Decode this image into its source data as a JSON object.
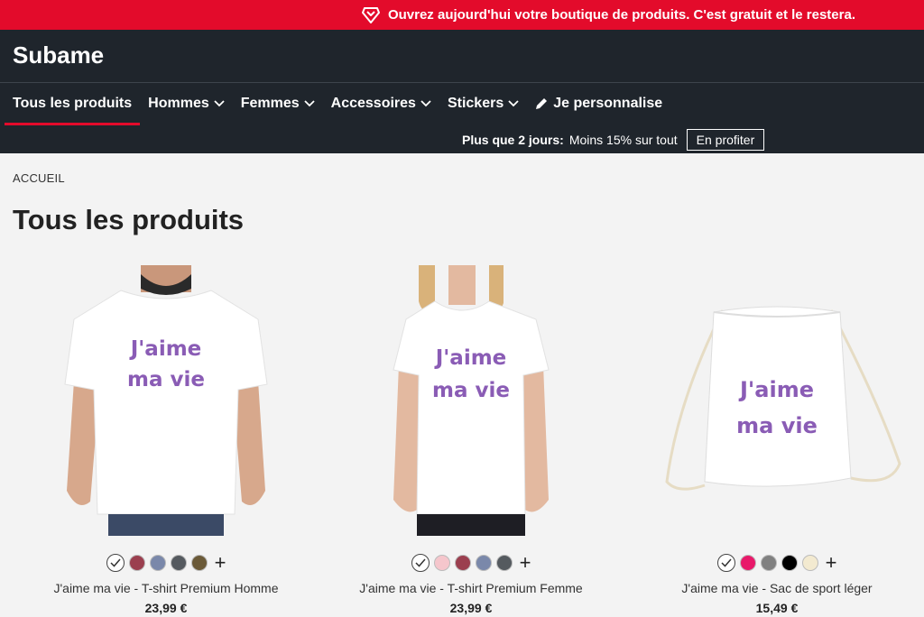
{
  "promo": {
    "text": "Ouvrez aujourd'hui votre boutique de produits. C'est gratuit et le restera.",
    "icon": "diamond-heart-icon"
  },
  "header": {
    "brand": "Subame",
    "nav": [
      {
        "label": "Tous les produits",
        "active": true
      },
      {
        "label": "Hommes",
        "dropdown": true
      },
      {
        "label": "Femmes",
        "dropdown": true
      },
      {
        "label": "Accessoires",
        "dropdown": true
      },
      {
        "label": "Stickers",
        "dropdown": true
      },
      {
        "label": "Je personnalise",
        "icon": "pencil-icon"
      }
    ],
    "offer": {
      "strong": "Plus que 2 jours:",
      "text": "Moins 15% sur tout",
      "button": "En profiter"
    }
  },
  "breadcrumb": "ACCUEIL",
  "page_title": "Tous les produits",
  "products": [
    {
      "design_text_1": "J'aime",
      "design_text_2": "ma vie",
      "name": "J'aime ma vie - T-shirt Premium Homme",
      "price": "23,99 €",
      "colors": [
        "#ffffff",
        "#9b3f4f",
        "#7a88aa",
        "#555a5f",
        "#6b5a38"
      ]
    },
    {
      "design_text_1": "J'aime",
      "design_text_2": "ma vie",
      "name": "J'aime ma vie - T-shirt Premium Femme",
      "price": "23,99 €",
      "colors": [
        "#ffffff",
        "#f5c6cc",
        "#9b3f4f",
        "#7a88aa",
        "#555a5f"
      ]
    },
    {
      "design_text_1": "J'aime",
      "design_text_2": "ma vie",
      "name": "J'aime ma vie - Sac de sport léger",
      "price": "15,49 €",
      "colors": [
        "#ffffff",
        "#e8196a",
        "#808080",
        "#000000",
        "#f3ead0"
      ]
    }
  ],
  "colors": {
    "promo_bg": "#e30b2b",
    "header_bg": "#1f252c",
    "design_purple": "#8a5cb5"
  }
}
